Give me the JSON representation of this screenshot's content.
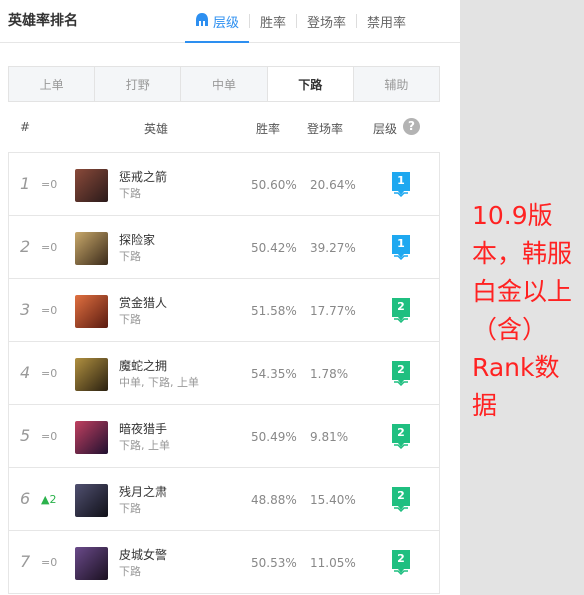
{
  "header": {
    "title": "英雄率排名",
    "tabs": [
      {
        "label": "层级",
        "active": true
      },
      {
        "label": "胜率",
        "active": false
      },
      {
        "label": "登场率",
        "active": false
      },
      {
        "label": "禁用率",
        "active": false
      }
    ]
  },
  "positions": [
    {
      "label": "上单",
      "active": false
    },
    {
      "label": "打野",
      "active": false
    },
    {
      "label": "中单",
      "active": false
    },
    {
      "label": "下路",
      "active": true
    },
    {
      "label": "辅助",
      "active": false
    }
  ],
  "columns": {
    "rank": "#",
    "hero": "英雄",
    "winrate": "胜率",
    "pickrate": "登场率",
    "tier": "层级",
    "help": "?"
  },
  "rows": [
    {
      "rank": "1",
      "change": "0",
      "change_dir": "same",
      "name": "惩戒之箭",
      "roles": "下路",
      "winrate": "50.60%",
      "pickrate": "20.64%",
      "tier": "1",
      "avatar_color": "#5b3a3a"
    },
    {
      "rank": "2",
      "change": "0",
      "change_dir": "same",
      "name": "探险家",
      "roles": "下路",
      "winrate": "50.42%",
      "pickrate": "39.27%",
      "tier": "1",
      "avatar_color": "#7a6a4a"
    },
    {
      "rank": "3",
      "change": "0",
      "change_dir": "same",
      "name": "赏金猎人",
      "roles": "下路",
      "winrate": "51.58%",
      "pickrate": "17.77%",
      "tier": "2",
      "avatar_color": "#a04a2a"
    },
    {
      "rank": "4",
      "change": "0",
      "change_dir": "same",
      "name": "魔蛇之拥",
      "roles": "中单, 下路, 上单",
      "winrate": "54.35%",
      "pickrate": "1.78%",
      "tier": "2",
      "avatar_color": "#6a5a2a"
    },
    {
      "rank": "5",
      "change": "0",
      "change_dir": "same",
      "name": "暗夜猎手",
      "roles": "下路, 上单",
      "winrate": "50.49%",
      "pickrate": "9.81%",
      "tier": "2",
      "avatar_color": "#3a3050"
    },
    {
      "rank": "6",
      "change": "2",
      "change_dir": "up",
      "name": "残月之肃",
      "roles": "下路",
      "winrate": "48.88%",
      "pickrate": "15.40%",
      "tier": "2",
      "avatar_color": "#2a2a3a"
    },
    {
      "rank": "7",
      "change": "0",
      "change_dir": "same",
      "name": "皮城女警",
      "roles": "下路",
      "winrate": "50.53%",
      "pickrate": "11.05%",
      "tier": "2",
      "avatar_color": "#4a3a5a"
    }
  ],
  "tier_colors": {
    "1": "#1ea8f0",
    "2": "#1fbf80"
  },
  "accent": "#2d8ff0",
  "note": {
    "text": "10.9版本，韩服白金以上（含）Rank数据",
    "color": "#ff2222"
  }
}
